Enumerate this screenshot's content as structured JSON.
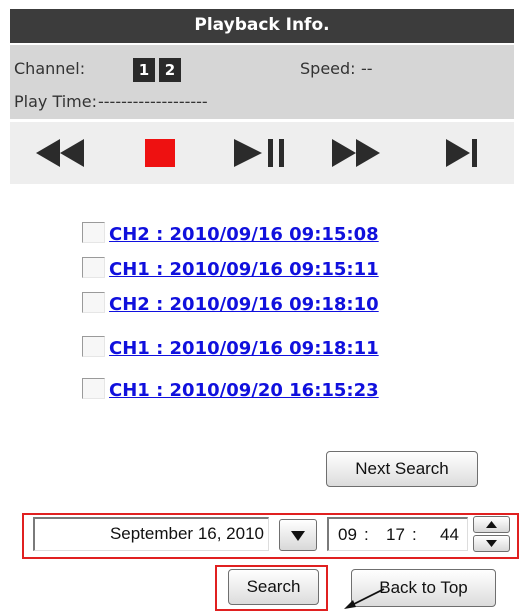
{
  "header": {
    "title": "Playback Info."
  },
  "info": {
    "channel_label": "Channel:",
    "channels": [
      "1",
      "2"
    ],
    "speed_label": "Speed:",
    "speed_value": "--",
    "play_time_label": "Play Time:",
    "play_time_value": "-------------------"
  },
  "controls": {
    "icons": [
      "rewind-icon",
      "stop-icon",
      "play-pause-icon",
      "fast-forward-icon",
      "next-frame-icon"
    ],
    "stop_color": "#ee1111"
  },
  "records": [
    "CH2 : 2010/09/16 09:15:08",
    "CH1 : 2010/09/16 09:15:11",
    "CH2 : 2010/09/16 09:18:10",
    "CH1 : 2010/09/16 09:18:11",
    "CH1 : 2010/09/20 16:15:23"
  ],
  "buttons": {
    "next_search": "Next Search",
    "search": "Search",
    "back_to_top": "Back to Top"
  },
  "datetime": {
    "date": "September 16, 2010",
    "hour": "09",
    "minute": "17",
    "second": "44",
    "separator": ":"
  },
  "colors": {
    "link": "#1010dd",
    "highlight_frame": "#e02020",
    "header_bg": "#3c3c3c"
  }
}
